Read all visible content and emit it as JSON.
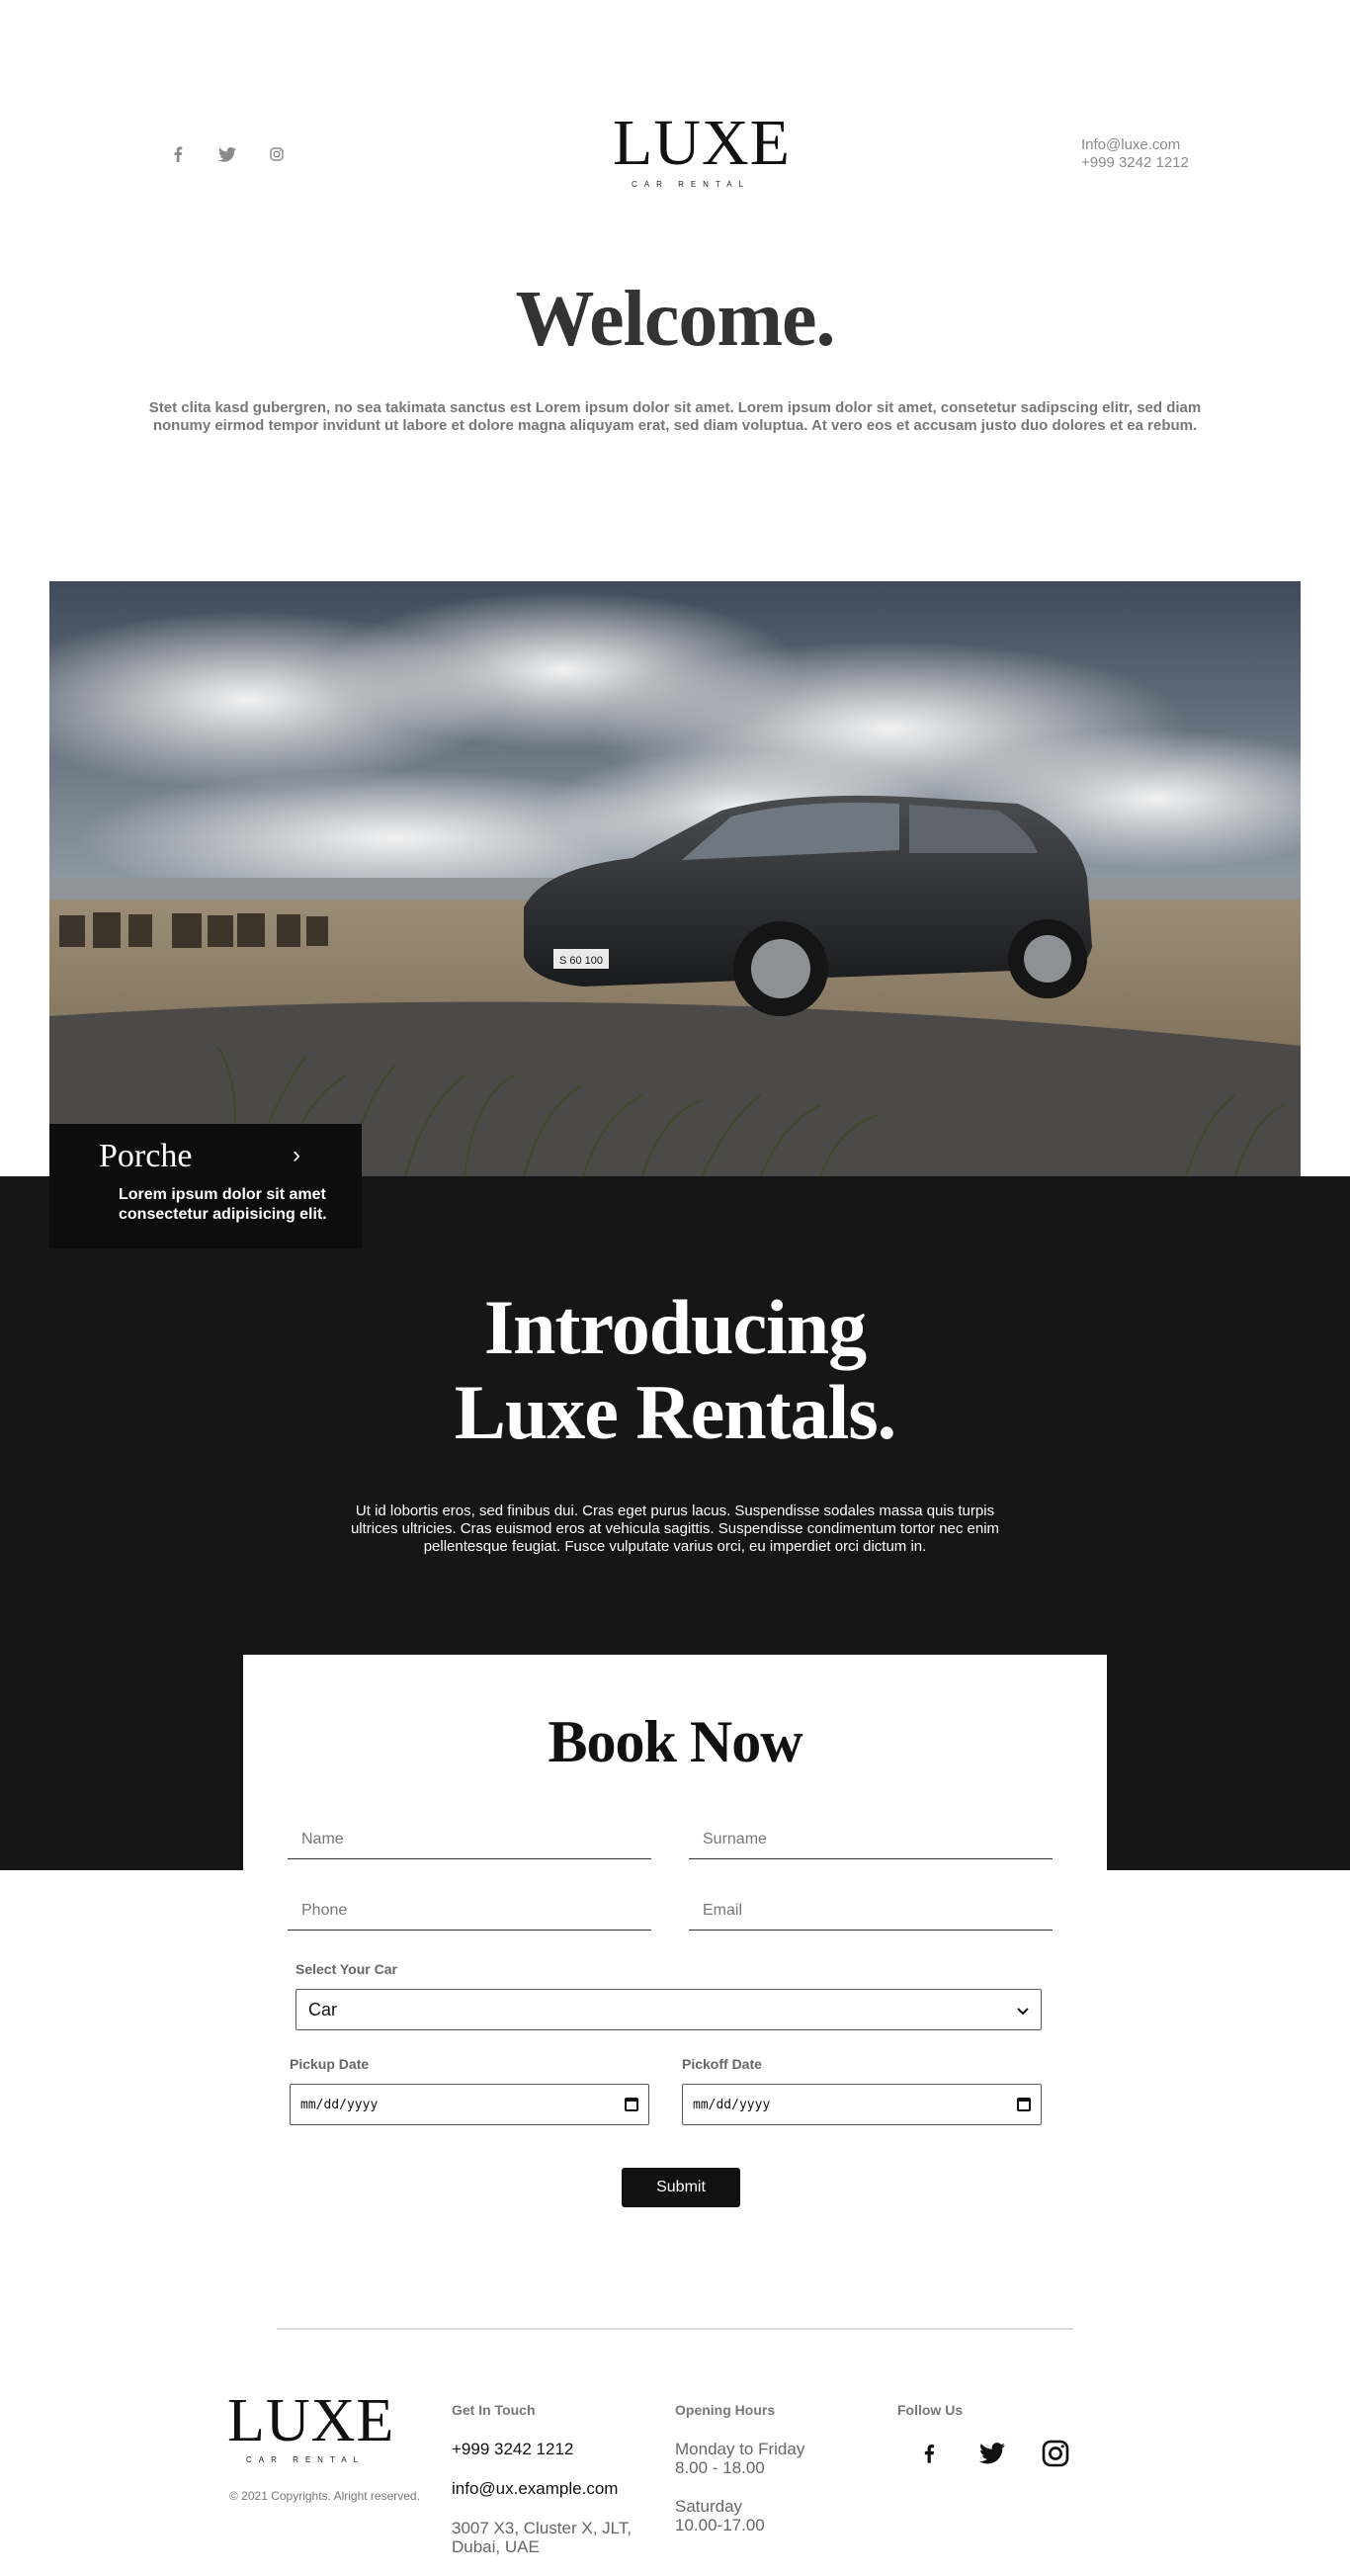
{
  "header": {
    "social": [
      {
        "icon": "facebook-icon",
        "glyph": "f"
      },
      {
        "icon": "twitter-icon",
        "glyph": ""
      },
      {
        "icon": "instagram-icon",
        "glyph": ""
      }
    ],
    "logo": {
      "word": "LUXE",
      "sub": "CAR RENTAL"
    },
    "contact_email": "Info@luxe.com",
    "contact_phone": "+999 3242 1212"
  },
  "welcome": {
    "title": "Welcome.",
    "text": "Stet clita kasd gubergren, no sea takimata sanctus est Lorem ipsum dolor sit amet. Lorem ipsum dolor sit amet, consetetur sadipscing elitr, sed diam nonumy eirmod tempor invidunt ut labore et dolore magna aliquyam erat, sed diam voluptua. At vero eos et accusam justo duo dolores et ea rebum."
  },
  "hero": {
    "plate": "S 60 100"
  },
  "car_card": {
    "name": "Porche",
    "arrow": "›",
    "desc": "Lorem ipsum dolor sit amet consectetur adipisicing elit."
  },
  "intro": {
    "title_line1": "Introducing",
    "title_line2": "Luxe Rentals.",
    "text": "Ut id lobortis eros, sed finibus dui. Cras eget purus lacus. Suspendisse sodales massa quis turpis ultrices ultricies. Cras euismod eros at vehicula sagittis. Suspendisse condimentum tortor nec enim pellentesque feugiat. Fusce vulputate varius orci, eu imperdiet orci dictum in."
  },
  "booking": {
    "title": "Book Now",
    "name_placeholder": "Name",
    "surname_placeholder": "Surname",
    "phone_placeholder": "Phone",
    "email_placeholder": "Email",
    "select_label": "Select Your Car",
    "select_value": "Car",
    "pickup_label": "Pickup Date",
    "pickoff_label": "Pickoff Date",
    "date_placeholder": "mm/dd/yyyy",
    "submit": "Submit"
  },
  "footer": {
    "logo": {
      "word": "LUXE",
      "sub": "CAR RENTAL"
    },
    "copyright": "© 2021 Copyrights. Alright reserved.",
    "get_in_touch": {
      "heading": "Get In Touch",
      "phone": "+999 3242 1212",
      "email": "info@ux.example.com",
      "address_line1": "3007 X3, Cluster X, JLT,",
      "address_line2": "Dubai, UAE"
    },
    "opening_hours": {
      "heading": "Opening Hours",
      "weekday_label": "Monday to Friday",
      "weekday_hours": "8.00 - 18.00",
      "saturday_label": "Saturday",
      "saturday_hours": "10.00-17.00"
    },
    "follow_us": {
      "heading": "Follow Us"
    }
  },
  "colors": {
    "dark_band": "#161616",
    "card": "#0d0d0d",
    "accent_text": "#111111",
    "muted_text": "#777777"
  }
}
